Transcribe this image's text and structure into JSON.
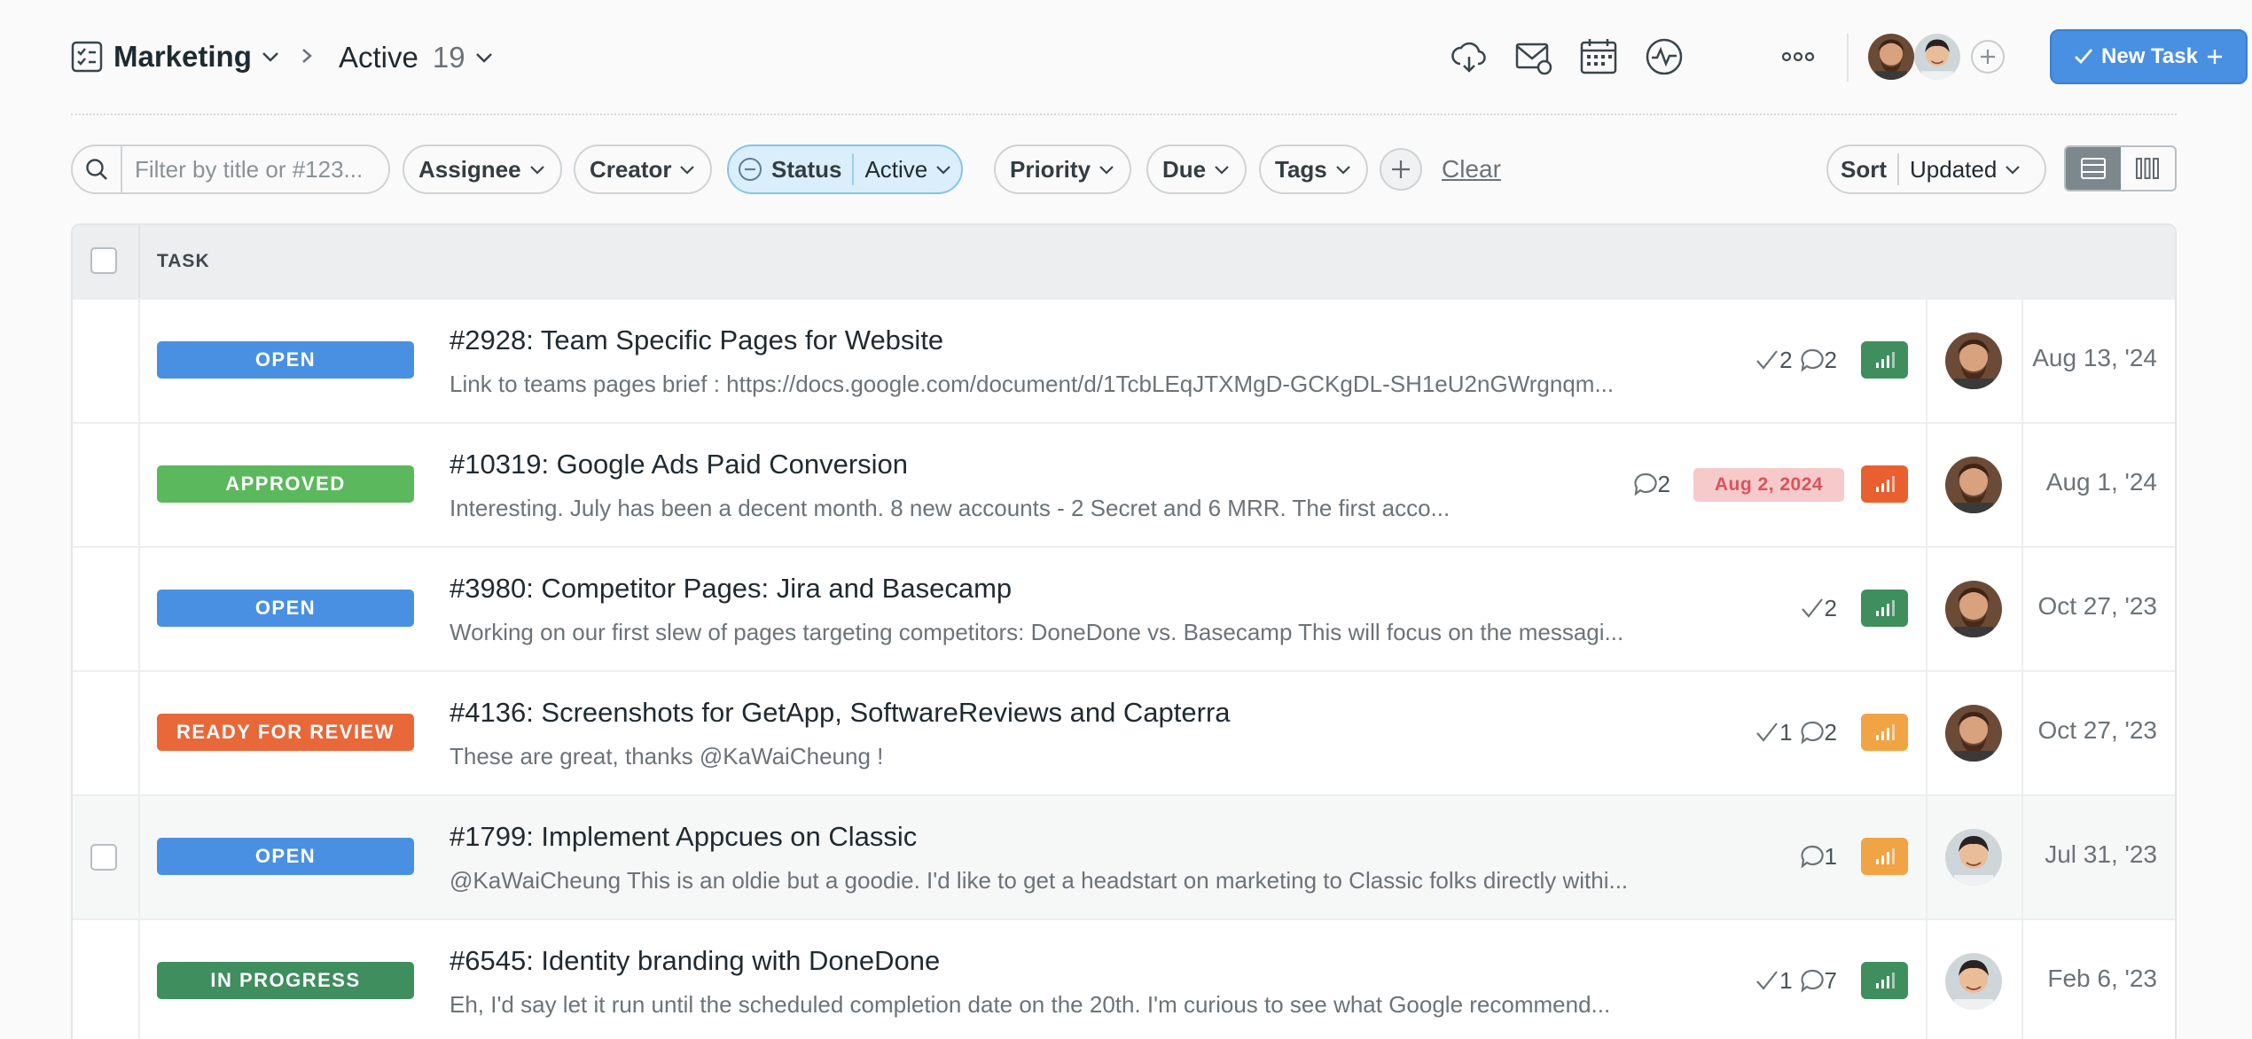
{
  "header": {
    "project_name": "Marketing",
    "view_name": "Active",
    "view_count": "19",
    "new_task_label": "New Task"
  },
  "filters": {
    "search_placeholder": "Filter by title or #123...",
    "assignee": "Assignee",
    "creator": "Creator",
    "status_label": "Status",
    "status_value": "Active",
    "priority": "Priority",
    "due": "Due",
    "tags": "Tags",
    "clear": "Clear",
    "sort_label": "Sort",
    "sort_value": "Updated"
  },
  "table": {
    "header_task": "TASK",
    "rows": [
      {
        "status": "OPEN",
        "status_color": "#4a90e2",
        "title": "#2928: Team Specific Pages for Website",
        "desc": "Link to teams pages brief  :  https://docs.google.com/document/d/1TcbLEqJTXMgD-GCKgDL-SH1eU2nGWrgnqm...",
        "checks": "2",
        "comments": "2",
        "due": "",
        "priority_color": "#3e8e5e",
        "avatar": "man-beard",
        "date": "Aug 13, '24"
      },
      {
        "status": "APPROVED",
        "status_color": "#5cb85c",
        "title": "#10319: Google Ads Paid Conversion",
        "desc": "Interesting. July has been a decent month. 8 new accounts - 2 Secret and 6 MRR. The first acco...",
        "checks": "",
        "comments": "2",
        "due": "Aug 2, 2024",
        "priority_color": "#e8602f",
        "avatar": "man-beard",
        "date": "Aug 1, '24"
      },
      {
        "status": "OPEN",
        "status_color": "#4a90e2",
        "title": "#3980: Competitor Pages: Jira and Basecamp",
        "desc": "Working on our first slew of pages targeting competitors: DoneDone vs. Basecamp This will focus on the messagi...",
        "checks": "2",
        "comments": "",
        "due": "",
        "priority_color": "#3e8e5e",
        "avatar": "man-beard",
        "date": "Oct 27, '23"
      },
      {
        "status": "READY FOR REVIEW",
        "status_color": "#e8683a",
        "title": "#4136: Screenshots for GetApp, SoftwareReviews and Capterra",
        "desc": "These are great, thanks  @KaWaiCheung !",
        "checks": "1",
        "comments": "2",
        "due": "",
        "priority_color": "#f0a444",
        "avatar": "man-beard",
        "date": "Oct 27, '23"
      },
      {
        "status": "OPEN",
        "status_color": "#4a90e2",
        "title": "#1799: Implement Appcues on Classic",
        "desc": " @KaWaiCheung This is an oldie but a goodie. I'd like to get a headstart on marketing to Classic folks directly withi...",
        "checks": "",
        "comments": "1",
        "due": "",
        "priority_color": "#f0a444",
        "avatar": "man-young",
        "date": "Jul 31, '23"
      },
      {
        "status": "IN PROGRESS",
        "status_color": "#3e8e5e",
        "title": "#6545: Identity branding with DoneDone",
        "desc": "Eh, I'd say let it run until the scheduled completion date on the 20th. I'm curious to see what Google recommend...",
        "checks": "1",
        "comments": "7",
        "due": "",
        "priority_color": "#3e8e5e",
        "avatar": "man-young",
        "date": "Feb 6, '23"
      }
    ]
  }
}
